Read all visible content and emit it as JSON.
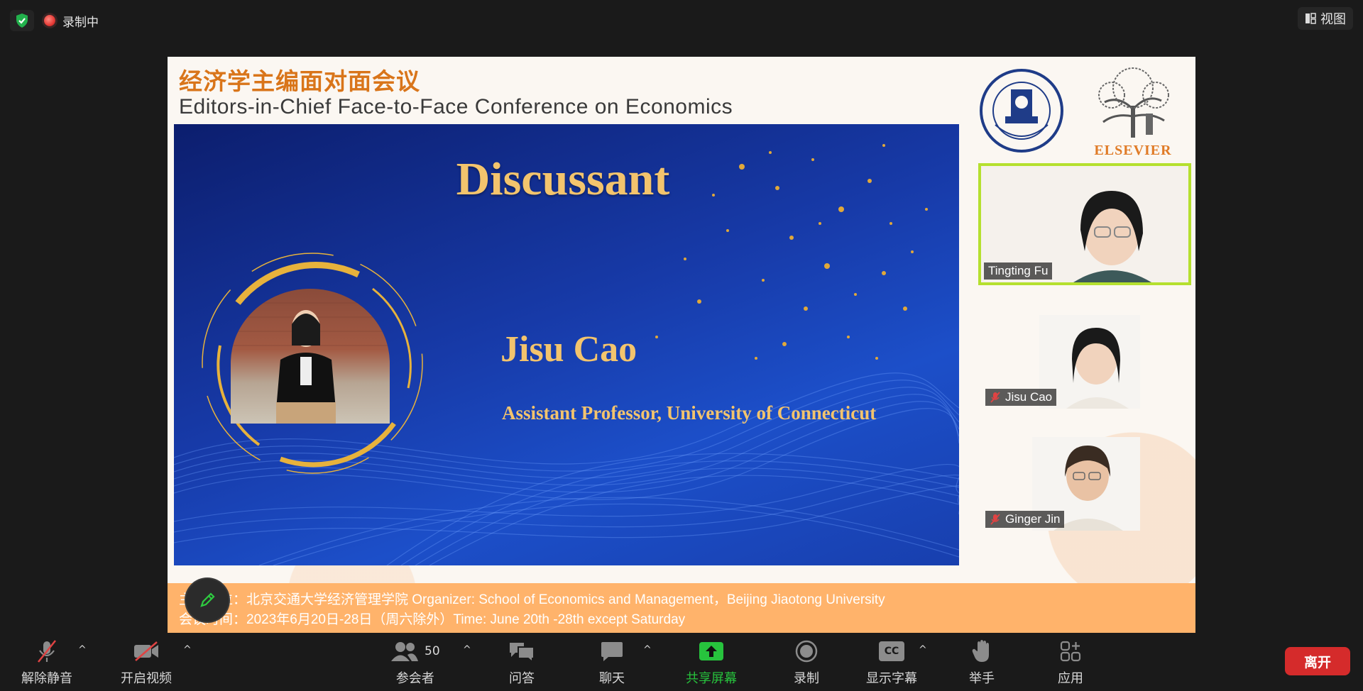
{
  "topbar": {
    "recording_label": "录制中",
    "view_label": "视图"
  },
  "slide": {
    "title_cn": "经济学主编面对面会议",
    "title_en": "Editors-in-Chief Face-to-Face Conference on Economics",
    "heading": "Discussant",
    "speaker_name": "Jisu Cao",
    "speaker_position": "Assistant Professor, University of Connecticut",
    "publisher_logo_text": "ELSEVIER",
    "footer_line1": "主办单位：北京交通大学经济管理学院 Organizer: School of Economics and Management，Beijing Jiaotong University",
    "footer_line2": "会议时间：2023年6月20日-28日（周六除外）Time: June 20th -28th except Saturday"
  },
  "participants": [
    {
      "name": "Tingting Fu",
      "muted": false,
      "active_speaker": true
    },
    {
      "name": "Jisu Cao",
      "muted": true,
      "active_speaker": false
    },
    {
      "name": "Ginger Jin",
      "muted": true,
      "active_speaker": false
    }
  ],
  "toolbar": {
    "unmute": "解除静音",
    "start_video": "开启视频",
    "participants": "参会者",
    "participants_count": "50",
    "qa": "问答",
    "chat": "聊天",
    "share_screen": "共享屏幕",
    "record": "录制",
    "captions": "显示字幕",
    "captions_badge": "CC",
    "raise_hand": "举手",
    "apps": "应用",
    "leave": "离开"
  },
  "colors": {
    "share_green": "#27c33d",
    "leave_red": "#d52b2b",
    "active_border": "#b5e02f",
    "slide_gold": "#f3c46d"
  }
}
